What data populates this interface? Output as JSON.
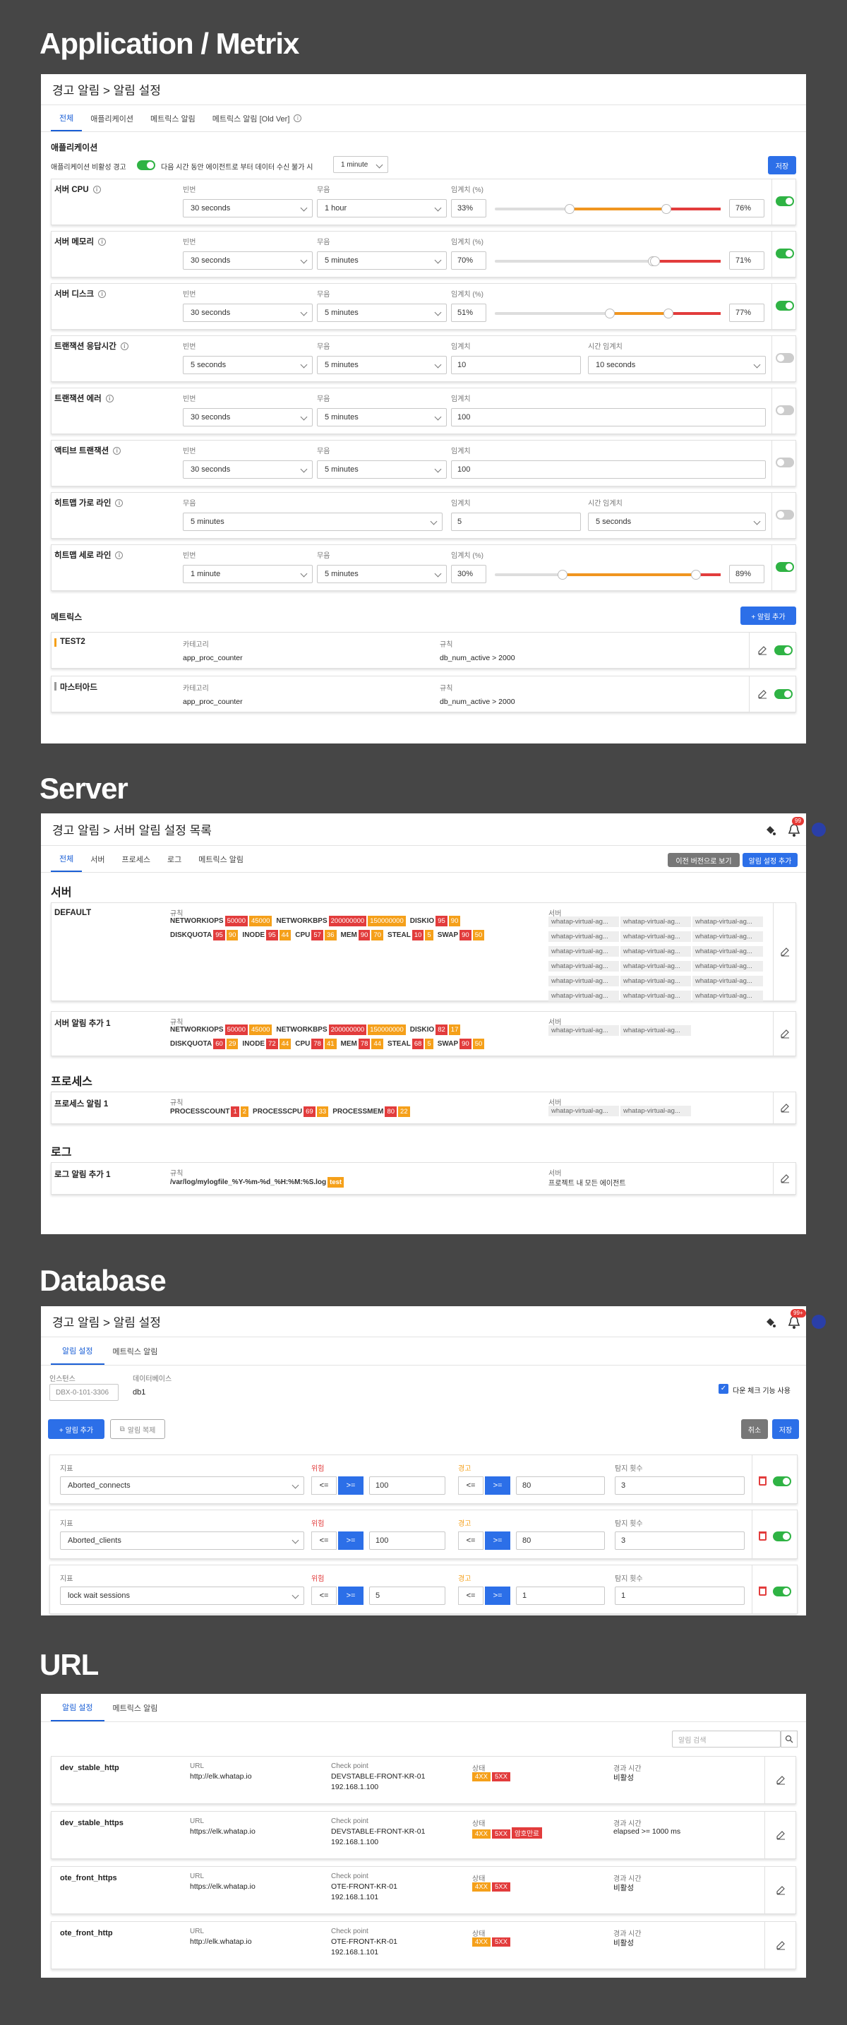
{
  "sections": {
    "app": "Application / Metrix",
    "server": "Server",
    "database": "Database",
    "url": "URL"
  },
  "app": {
    "header": "경고 알림 > 알림 설정",
    "tabs": [
      "전체",
      "애플리케이션",
      "메트릭스 알림",
      "메트릭스 알림 [Old Ver]"
    ],
    "section_title": "애플리케이션",
    "inactive_label": "애플리케이션 비활성 경고",
    "inactive_desc": "다음 시간 동안 에이전트로 부터 데이터 수신 불가 시",
    "inactive_value": "1 minute",
    "save": "저장",
    "labels": {
      "freq": "빈번",
      "silence": "무음",
      "threshold": "임계치",
      "threshold_pct": "임계치 (%)",
      "time_threshold": "시간 임계치"
    },
    "rows": [
      {
        "title": "서버 CPU",
        "freq": "30 seconds",
        "silence": "1 hour",
        "warn": "33%",
        "crit": "76%",
        "slider": [
          0.33,
          0.76
        ],
        "on": true
      },
      {
        "title": "서버 메모리",
        "freq": "30 seconds",
        "silence": "5 minutes",
        "warn": "70%",
        "crit": "71%",
        "slider": [
          0.7,
          0.71
        ],
        "on": true
      },
      {
        "title": "서버 디스크",
        "freq": "30 seconds",
        "silence": "5 minutes",
        "warn": "51%",
        "crit": "77%",
        "slider": [
          0.51,
          0.77
        ],
        "on": true
      },
      {
        "title": "트랜잭션 응답시간",
        "freq": "5 seconds",
        "silence": "5 minutes",
        "value": "10",
        "time": "10 seconds",
        "on": false
      },
      {
        "title": "트랜잭션 에러",
        "freq": "30 seconds",
        "silence": "5 minutes",
        "value": "100",
        "on": false
      },
      {
        "title": "액티브 트랜잭션",
        "freq": "30 seconds",
        "silence": "5 minutes",
        "value": "100",
        "on": false
      },
      {
        "title": "히트맵 가로 라인",
        "silence": "5 minutes",
        "value": "5",
        "time": "5 seconds",
        "on": false
      },
      {
        "title": "히트맵 세로 라인",
        "freq": "1 minute",
        "silence": "5 minutes",
        "warn": "30%",
        "crit": "89%",
        "slider": [
          0.3,
          0.89
        ],
        "on": true
      }
    ],
    "metrics_title": "메트릭스",
    "add_alert": "+ 알림 추가",
    "metric_labels": {
      "category": "카테고리",
      "rule": "규칙"
    },
    "metrics": [
      {
        "title": "TEST2",
        "category": "app_proc_counter",
        "rule": "db_num_active > 2000",
        "color": "#f5a01a",
        "on": true
      },
      {
        "title": "마스터아드",
        "category": "app_proc_counter",
        "rule": "db_num_active > 2000",
        "color": "#999",
        "on": true
      }
    ]
  },
  "server": {
    "header": "경고 알림 > 서버 알림 설정 목록",
    "notif_count": "99",
    "tabs": [
      "전체",
      "서버",
      "프로세스",
      "로그",
      "메트릭스 알림"
    ],
    "prev_ver": "이전 버전으로 보기",
    "add": "알림 설정 추가",
    "labels": {
      "rule": "규칙",
      "server": "서버"
    },
    "group_server": "서버",
    "group_process": "프로세스",
    "group_log": "로그",
    "default": {
      "title": "DEFAULT",
      "line1": [
        [
          "NETWORKIOPS",
          "50000",
          "45000"
        ],
        [
          "NETWORKBPS",
          "200000000",
          "150000000"
        ],
        [
          "DISKIO",
          "95",
          "90"
        ]
      ],
      "line2": [
        [
          "DISKQUOTA",
          "95",
          "90"
        ],
        [
          "INODE",
          "95",
          "44"
        ],
        [
          "CPU",
          "57",
          "36"
        ],
        [
          "MEM",
          "90",
          "70"
        ],
        [
          "STEAL",
          "10",
          "5"
        ],
        [
          "SWAP",
          "90",
          "50"
        ]
      ],
      "servers": [
        "whatap-virtual-ag...",
        "whatap-virtual-ag...",
        "whatap-virtual-ag...",
        "whatap-virtual-ag...",
        "whatap-virtual-ag...",
        "whatap-virtual-ag...",
        "whatap-virtual-ag...",
        "whatap-virtual-ag...",
        "whatap-virtual-ag...",
        "whatap-virtual-ag...",
        "whatap-virtual-ag...",
        "whatap-virtual-ag...",
        "whatap-virtual-ag...",
        "whatap-virtual-ag...",
        "whatap-virtual-ag...",
        "whatap-virtual-ag...",
        "whatap-virtual-ag...",
        "whatap-virtual-ag..."
      ]
    },
    "add1": {
      "title": "서버 알림 추가 1",
      "line1": [
        [
          "NETWORKIOPS",
          "50000",
          "45000"
        ],
        [
          "NETWORKBPS",
          "200000000",
          "150000000"
        ],
        [
          "DISKIO",
          "82",
          "17"
        ]
      ],
      "line2": [
        [
          "DISKQUOTA",
          "60",
          "29"
        ],
        [
          "INODE",
          "72",
          "44"
        ],
        [
          "CPU",
          "78",
          "41"
        ],
        [
          "MEM",
          "78",
          "44"
        ],
        [
          "STEAL",
          "68",
          "5"
        ],
        [
          "SWAP",
          "90",
          "50"
        ]
      ],
      "servers": [
        "whatap-virtual-ag...",
        "whatap-virtual-ag..."
      ]
    },
    "proc": {
      "title": "프로세스 알림 1",
      "line1": [
        [
          "PROCESSCOUNT",
          "1",
          "2"
        ],
        [
          "PROCESSCPU",
          "69",
          "33"
        ],
        [
          "PROCESSMEM",
          "80",
          "22"
        ]
      ],
      "servers": [
        "whatap-virtual-ag...",
        "whatap-virtual-ag..."
      ]
    },
    "log": {
      "title": "로그 알림 추가 1",
      "rule": "/var/log/mylogfile_%Y-%m-%d_%H:%M:%S.log",
      "tag": "test",
      "server": "프로젝트 내 모든 에이전트"
    }
  },
  "db": {
    "header": "경고 알림 > 알림 설정",
    "notif_count": "99+",
    "tabs": [
      "알림 설정",
      "메트릭스 알림"
    ],
    "instance_label": "인스턴스",
    "instance_value": "DBX-0-101-3306",
    "db_label": "데이터베이스",
    "db_value": "db1",
    "down_check": "다운 체크 기능 사용",
    "add": "+ 알림 추가",
    "copy": "알림 복제",
    "cancel": "취소",
    "save": "저장",
    "labels": {
      "metric": "지표",
      "danger": "위험",
      "warn": "경고",
      "count": "탐지 횟수"
    },
    "ops": [
      "<=",
      ">="
    ],
    "rows": [
      {
        "metric": "Aborted_connects",
        "danger": "100",
        "warn": "80",
        "count": "3"
      },
      {
        "metric": "Aborted_clients",
        "danger": "100",
        "warn": "80",
        "count": "3"
      },
      {
        "metric": "lock wait sessions",
        "danger": "5",
        "warn": "1",
        "count": "1"
      }
    ]
  },
  "url": {
    "tabs": [
      "알림 설정",
      "메트릭스 알림"
    ],
    "search_placeholder": "알림 검색",
    "labels": {
      "url": "URL",
      "checkpoint": "Check point",
      "status": "상태",
      "elapsed": "경과 시간"
    },
    "rows": [
      {
        "name": "dev_stable_http",
        "url": "http://elk.whatap.io",
        "cp1": "DEVSTABLE-FRONT-KR-01",
        "cp2": "192.168.1.100",
        "tags": [
          "4XX",
          "5XX"
        ],
        "elapsed": "비활성"
      },
      {
        "name": "dev_stable_https",
        "url": "https://elk.whatap.io",
        "cp1": "DEVSTABLE-FRONT-KR-01",
        "cp2": "192.168.1.100",
        "tags": [
          "4XX",
          "5XX",
          "암호만료"
        ],
        "elapsed": "elapsed >= 1000 ms"
      },
      {
        "name": "ote_front_https",
        "url": "https://elk.whatap.io",
        "cp1": "OTE-FRONT-KR-01",
        "cp2": "192.168.1.101",
        "tags": [
          "4XX",
          "5XX"
        ],
        "elapsed": "비활성"
      },
      {
        "name": "ote_front_http",
        "url": "http://elk.whatap.io",
        "cp1": "OTE-FRONT-KR-01",
        "cp2": "192.168.1.101",
        "tags": [
          "4XX",
          "5XX"
        ],
        "elapsed": "비활성"
      }
    ]
  }
}
